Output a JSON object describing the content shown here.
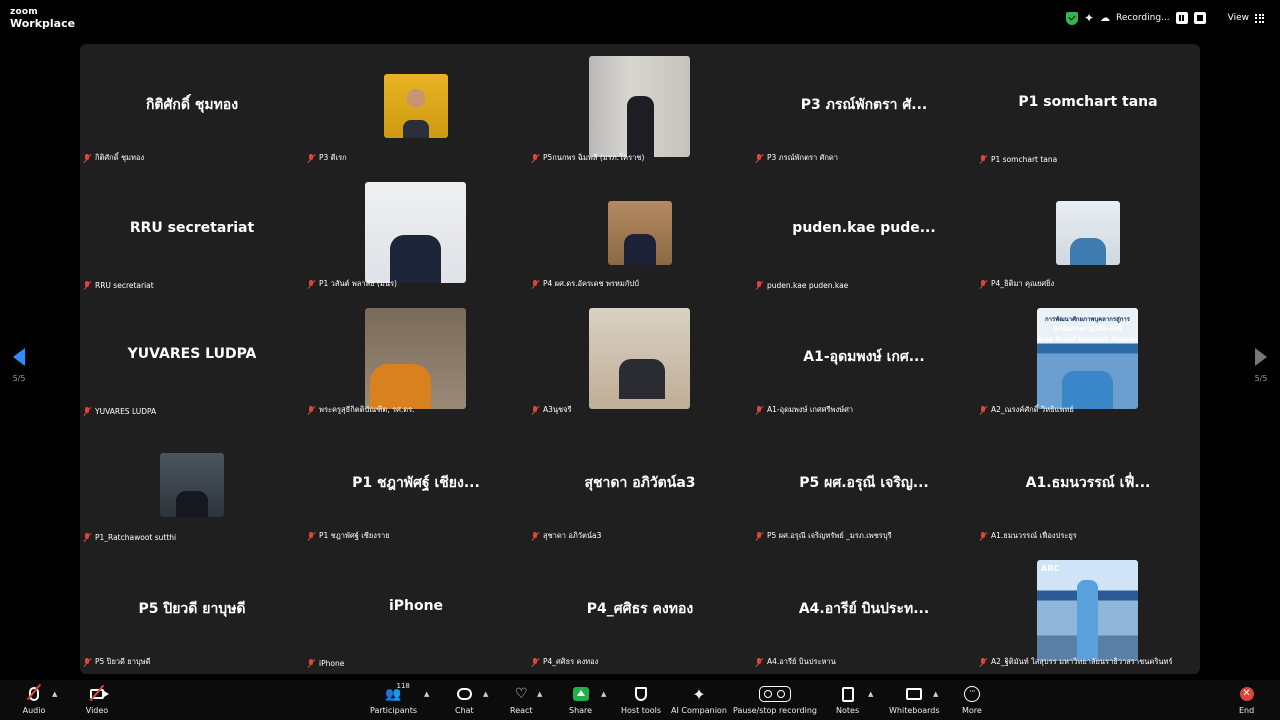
{
  "titlebar": {
    "logo_line1": "zoom",
    "logo_line2": "Workplace",
    "recording_label": "Recording...",
    "view_label": "View"
  },
  "pagination": {
    "left": "5/5",
    "right": "5/5"
  },
  "participants": [
    {
      "big": "กิติศักดิ์ ชุมทอง",
      "label": "กิติศักดิ์ ชุมทอง"
    },
    {
      "big": "",
      "label": "P3 ตีเรก"
    },
    {
      "big": "",
      "label": "P5กนกพร ฉิมพลี (มรภ.โคราช)"
    },
    {
      "big": "P3 ภรณ์พักตรา ศั...",
      "label": "P3 ภรณ์พักตรา ศักดา"
    },
    {
      "big": "P1 somchart tana",
      "label": "P1 somchart tana"
    },
    {
      "big": "RRU secretariat",
      "label": "RRU secretariat"
    },
    {
      "big": "",
      "label": "P1 วสันต์ พลาสัย (มนร)"
    },
    {
      "big": "",
      "label": "P4 ผศ.ดร.อัครเดช พรหมกัปป์"
    },
    {
      "big": "puden.kae  pude...",
      "label": "puden.kae puden.kae"
    },
    {
      "big": "",
      "label": "P4_ธิติมา คุณยศยิ่ง"
    },
    {
      "big": "YUVARES LUDPA",
      "label": "YUVARES LUDPA"
    },
    {
      "big": "",
      "label": "พระครูสุธีกิตติบัณฑิต, รศ.ดร."
    },
    {
      "big": "",
      "label": "A3นุชจรี"
    },
    {
      "big": "A1-อุดมพงษ์ เกศ...",
      "label": "A1-อุดมพงษ์ เกศศรีพงษ์ศา"
    },
    {
      "big": "",
      "label": "A2_ณรงค์ศักดิ์ วิหธิแพทย์"
    },
    {
      "big": "",
      "label": "P1_Ratchawoot sutthi"
    },
    {
      "big": "P1 ชฎาพัศฐ์ เชียง...",
      "label": "P1 ชฎาพัศฐ์ เชียงราย"
    },
    {
      "big": "สุชาดา อภิวัตน์a3",
      "label": "สุชาดา อภิวัตน์a3"
    },
    {
      "big": "P5 ผศ.อรุณี เจริญ...",
      "label": "P5 ผศ.อรุณี เจริญทรัพย์ _มรภ.เพชรบุรี"
    },
    {
      "big": "A1.ธมนวรรณ์ เฟื่...",
      "label": "A1.ธมนวรรณ์ เฟื่องประยูร"
    },
    {
      "big": "P5 ปิยวดี ยาบุษดี",
      "label": "P5 ปิยวดี ยาบุษดี"
    },
    {
      "big": "iPhone",
      "label": "iPhone"
    },
    {
      "big": "P4_ศศิธร คงทอง",
      "label": "P4_ศศิธร คงทอง"
    },
    {
      "big": "A4.อารีย์ บินประท...",
      "label": "A4.อารีย์ บินประหาน"
    },
    {
      "big": "",
      "label": "A2_ฐิติมันท์ ใสสุบรร มหาวิทยาลัยนราธิวาสราชนครินทร์"
    }
  ],
  "photo_captions": {
    "banner": "การพัฒนาศักยภาพบุคลากรสู่การ",
    "banner2": "นักจัดการงานวิจัยเชิงพื้",
    "banner3": "Area Based Research Manage",
    "city": "ARC"
  },
  "toolbar": {
    "audio": "Audio",
    "video": "Video",
    "participants": "Participants",
    "participants_count": "118",
    "chat": "Chat",
    "react": "React",
    "share": "Share",
    "host_tools": "Host tools",
    "ai_companion": "AI Companion",
    "pause_recording": "Pause/stop recording",
    "notes": "Notes",
    "whiteboards": "Whiteboards",
    "more": "More",
    "end": "End"
  },
  "colors": {
    "accent": "#2d8cff",
    "muted_red": "#e0433a",
    "share_green": "#21b14b",
    "tile_bg": "#1f1f1f"
  }
}
